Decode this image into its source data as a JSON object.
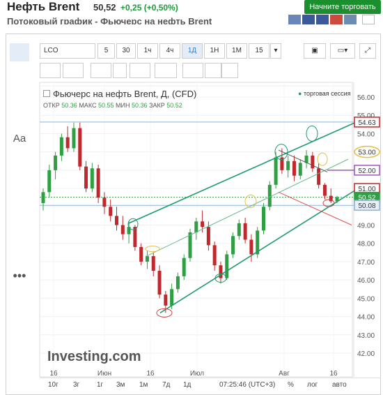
{
  "header": {
    "title": "Нефть Brent",
    "price": "50,52",
    "change": "+0,25 (+0,50%)",
    "trade_button": "Начните торговать",
    "subtitle": "Потоковый график - Фьючерс на нефть Brent"
  },
  "toolbar": {
    "symbol": "LCO",
    "intervals": [
      "5",
      "30",
      "1ч",
      "4ч",
      "1Д",
      "1Н",
      "1М",
      "15"
    ],
    "active_interval": "1Д"
  },
  "left_tools": [
    "crosshair-icon",
    "line-icon",
    "fib-icon",
    "brush-icon",
    "text-icon",
    "pattern-icon",
    "measure-icon",
    "back-arrow-icon",
    "zoom-icon",
    "ruler-icon",
    "more-icon"
  ],
  "left_tools_text": "Aa",
  "legend": {
    "title": "Фьючерс на нефть Brent, Д, (CFD)",
    "session": "торговая сессия",
    "ohlc_labels": [
      "ОТКР",
      "МАКС",
      "МИН",
      "ЗАКР"
    ],
    "ohlc_values": [
      "50.36",
      "50.55",
      "50.36",
      "50.52"
    ]
  },
  "colors": {
    "up": "#2ea043",
    "down": "#c0282d",
    "trend": "#1e9a6e",
    "accent": "#3a7bc8"
  },
  "chart_data": {
    "type": "candlestick",
    "y_axis_ticks": [
      "56.00",
      "55.00",
      "54.00",
      "53.00",
      "52.00",
      "51.00",
      "50.00",
      "49.00",
      "48.00",
      "47.00",
      "46.00",
      "45.00",
      "44.00",
      "43.00",
      "42.00"
    ],
    "x_axis_ticks": [
      "16",
      "Июн",
      "16",
      "Июл",
      "Авг",
      "16"
    ],
    "ylim": [
      41.5,
      56.5
    ],
    "price_labels": [
      {
        "value": "54.63",
        "style": "red-box"
      },
      {
        "value": "53.00",
        "style": "yellow-oval"
      },
      {
        "value": "52.00",
        "style": "purple-box"
      },
      {
        "value": "51.00",
        "style": "red-box"
      },
      {
        "value": "50.52",
        "style": "green"
      },
      {
        "value": "50.08",
        "style": "blue"
      }
    ],
    "candles": [
      [
        50.2,
        51.0,
        49.8,
        50.8
      ],
      [
        50.8,
        52.3,
        50.5,
        52.0
      ],
      [
        52.0,
        53.0,
        51.5,
        52.8
      ],
      [
        52.8,
        54.0,
        52.5,
        53.8
      ],
      [
        53.8,
        54.4,
        53.0,
        53.2
      ],
      [
        53.2,
        54.6,
        53.0,
        54.3
      ],
      [
        54.3,
        54.6,
        52.0,
        52.2
      ],
      [
        52.2,
        52.5,
        50.8,
        51.0
      ],
      [
        51.0,
        52.4,
        50.8,
        52.1
      ],
      [
        52.1,
        52.3,
        50.2,
        50.5
      ],
      [
        50.5,
        50.8,
        49.6,
        50.0
      ],
      [
        50.0,
        50.4,
        49.2,
        49.5
      ],
      [
        49.5,
        50.0,
        48.7,
        49.0
      ],
      [
        49.0,
        49.5,
        48.2,
        48.5
      ],
      [
        48.5,
        49.2,
        48.0,
        48.9
      ],
      [
        48.9,
        49.0,
        47.6,
        47.8
      ],
      [
        47.8,
        48.0,
        46.8,
        47.0
      ],
      [
        47.0,
        47.6,
        46.6,
        47.3
      ],
      [
        47.3,
        47.5,
        46.2,
        46.5
      ],
      [
        46.5,
        46.8,
        45.0,
        45.2
      ],
      [
        45.2,
        45.4,
        44.2,
        44.6
      ],
      [
        44.6,
        45.8,
        44.4,
        45.5
      ],
      [
        45.5,
        46.4,
        45.3,
        46.2
      ],
      [
        46.2,
        47.4,
        46.0,
        47.2
      ],
      [
        47.2,
        48.8,
        47.0,
        48.6
      ],
      [
        48.6,
        49.4,
        48.2,
        49.2
      ],
      [
        49.2,
        49.8,
        48.6,
        48.9
      ],
      [
        48.9,
        49.2,
        47.6,
        47.9
      ],
      [
        47.9,
        48.1,
        46.5,
        46.8
      ],
      [
        46.8,
        47.0,
        45.8,
        46.1
      ],
      [
        46.1,
        47.6,
        46.0,
        47.4
      ],
      [
        47.4,
        48.6,
        47.2,
        48.4
      ],
      [
        48.4,
        49.3,
        48.2,
        49.1
      ],
      [
        49.1,
        49.4,
        48.0,
        48.2
      ],
      [
        48.2,
        48.5,
        47.0,
        47.4
      ],
      [
        47.4,
        48.9,
        47.2,
        48.7
      ],
      [
        48.7,
        50.2,
        48.5,
        50.0
      ],
      [
        50.0,
        51.4,
        49.8,
        51.2
      ],
      [
        51.2,
        53.0,
        51.0,
        52.7
      ],
      [
        52.7,
        53.2,
        51.8,
        52.0
      ],
      [
        52.0,
        52.8,
        51.6,
        52.5
      ],
      [
        52.5,
        52.8,
        51.4,
        51.7
      ],
      [
        51.7,
        52.6,
        51.5,
        52.4
      ],
      [
        52.4,
        53.1,
        52.1,
        52.8
      ],
      [
        52.8,
        53.0,
        51.9,
        52.1
      ],
      [
        52.1,
        52.4,
        51.0,
        51.2
      ],
      [
        51.2,
        51.3,
        50.4,
        50.6
      ],
      [
        50.6,
        51.0,
        50.2,
        50.3
      ],
      [
        50.3,
        50.6,
        50.2,
        50.52
      ]
    ]
  },
  "watermark": "Investing.com",
  "bottom": {
    "ranges": [
      "10г",
      "3г",
      "1г",
      "3м",
      "1м",
      "7д",
      "1д"
    ],
    "time": "07:25:46 (UTC+3)",
    "options": [
      "%",
      "лог",
      "авто"
    ]
  }
}
